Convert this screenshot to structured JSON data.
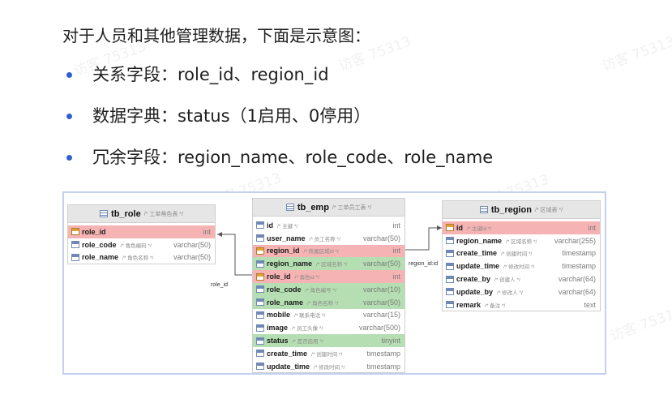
{
  "intro": "对于人员和其他管理数据，下面是示意图：",
  "bullets": [
    "关系字段：role_id、region_id",
    "数据字典：status（1启用、0停用）",
    "冗余字段：region_name、role_code、role_name"
  ],
  "watermark": "访客 75313",
  "colors": {
    "accent": "#2f5fd0",
    "primary_key_row": "#f5b3b3",
    "foreign_key_row": "#b5dfb2",
    "header": "#e6e6e6",
    "frame": "#c3d1ee"
  },
  "tables": {
    "tb_role": {
      "name": "tb_role",
      "comment": "/* 工单角色表 */",
      "columns": [
        {
          "name": "role_id",
          "comment": "",
          "type": "int",
          "key": "pk"
        },
        {
          "name": "role_code",
          "comment": "/* 角色编码 */",
          "type": "varchar(50)",
          "key": ""
        },
        {
          "name": "role_name",
          "comment": "/* 角色名称 */",
          "type": "varchar(50)",
          "key": ""
        }
      ]
    },
    "tb_emp": {
      "name": "tb_emp",
      "comment": "/* 工单员工表 */",
      "columns": [
        {
          "name": "id",
          "comment": "/* 主键 */",
          "type": "int",
          "key": ""
        },
        {
          "name": "user_name",
          "comment": "/* 员工名称 */",
          "type": "varchar(50)",
          "key": ""
        },
        {
          "name": "region_id",
          "comment": "/* 所属区域id */",
          "type": "int",
          "key": "pk"
        },
        {
          "name": "region_name",
          "comment": "/* 区域名称 */",
          "type": "varchar(50)",
          "key": "fk"
        },
        {
          "name": "role_id",
          "comment": "/* 角色id */",
          "type": "int",
          "key": "pk"
        },
        {
          "name": "role_code",
          "comment": "/* 角色编号 */",
          "type": "varchar(10)",
          "key": "fk"
        },
        {
          "name": "role_name",
          "comment": "/* 角色名称 */",
          "type": "varchar(50)",
          "key": "fk"
        },
        {
          "name": "mobile",
          "comment": "/* 联系电话 */",
          "type": "varchar(15)",
          "key": ""
        },
        {
          "name": "image",
          "comment": "/* 员工头像 */",
          "type": "varchar(500)",
          "key": ""
        },
        {
          "name": "status",
          "comment": "/* 是否启用 */",
          "type": "tinyint",
          "key": "fk"
        },
        {
          "name": "create_time",
          "comment": "/* 创建时间 */",
          "type": "timestamp",
          "key": ""
        },
        {
          "name": "update_time",
          "comment": "/* 修改时间 */",
          "type": "timestamp",
          "key": ""
        }
      ]
    },
    "tb_region": {
      "name": "tb_region",
      "comment": "/* 区域表 */",
      "columns": [
        {
          "name": "id",
          "comment": "/* 主键id */",
          "type": "int",
          "key": "pk"
        },
        {
          "name": "region_name",
          "comment": "/* 区域名称 */",
          "type": "varchar(255)",
          "key": ""
        },
        {
          "name": "create_time",
          "comment": "/* 创建时间 */",
          "type": "timestamp",
          "key": ""
        },
        {
          "name": "update_time",
          "comment": "/* 修改时间 */",
          "type": "timestamp",
          "key": ""
        },
        {
          "name": "create_by",
          "comment": "/* 创建人 */",
          "type": "varchar(64)",
          "key": ""
        },
        {
          "name": "update_by",
          "comment": "/* 修改人 */",
          "type": "varchar(64)",
          "key": ""
        },
        {
          "name": "remark",
          "comment": "/* 备注 */",
          "type": "text",
          "key": ""
        }
      ]
    }
  },
  "relations": {
    "role_label": "role_id",
    "region_label": "region_id:id"
  }
}
